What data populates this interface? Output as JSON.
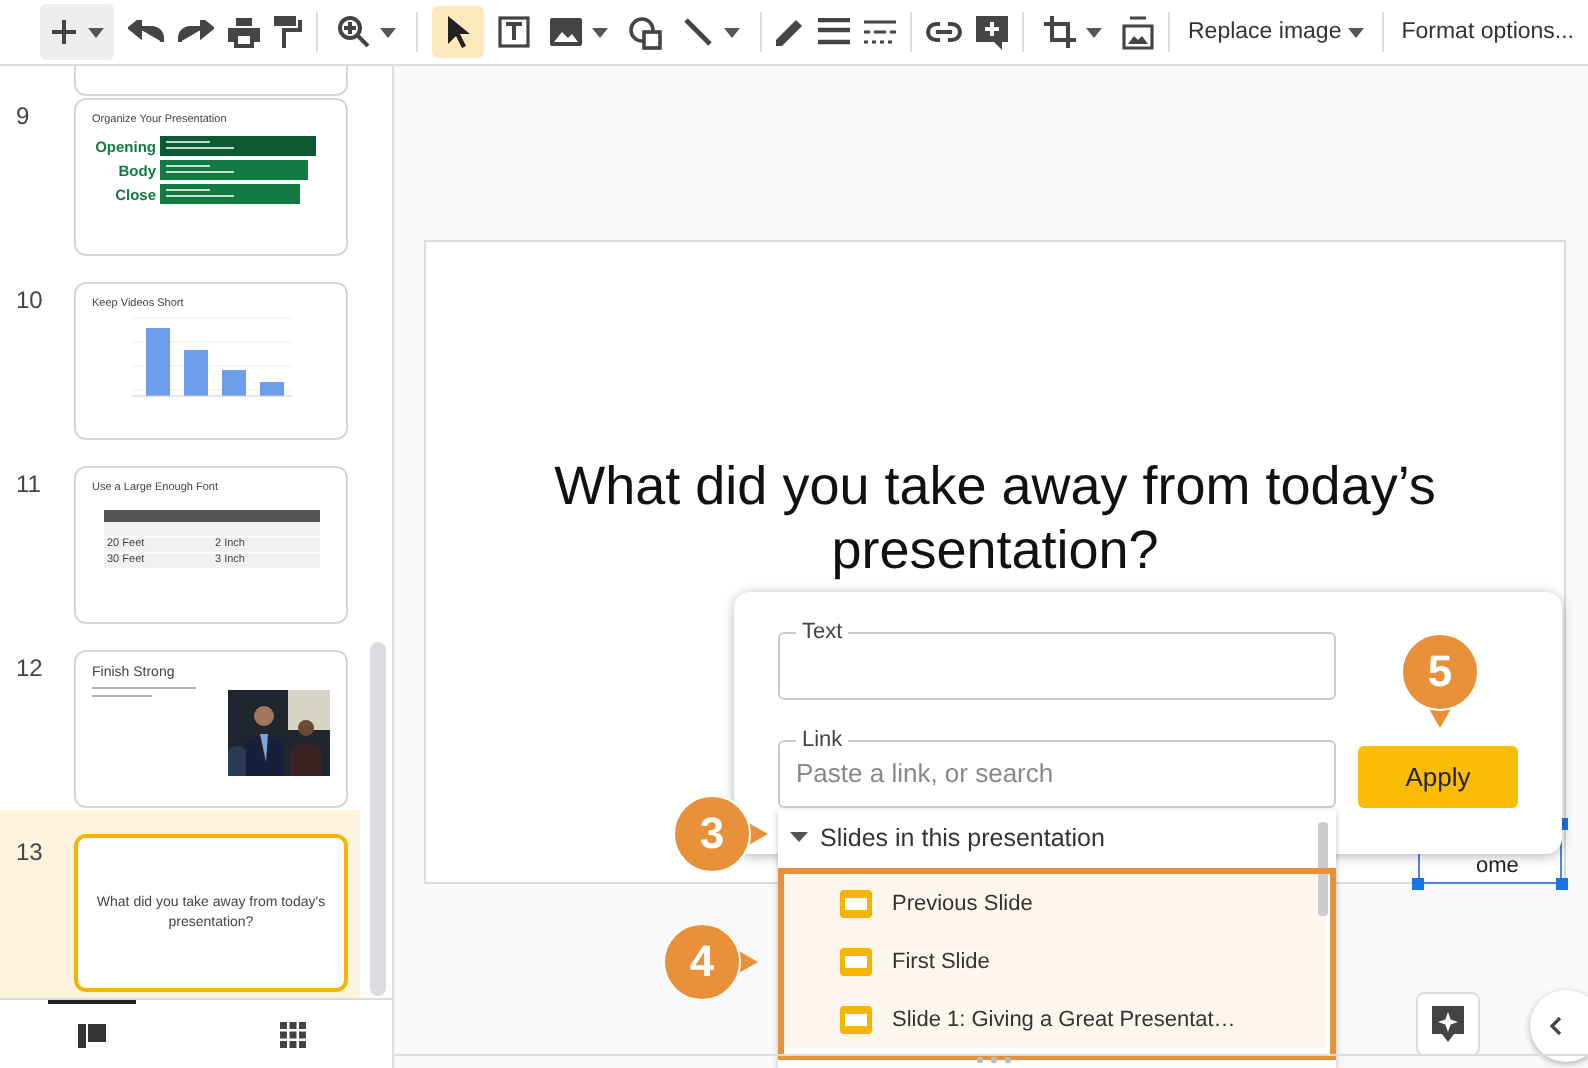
{
  "toolbar": {
    "pointer_selected": true,
    "buttons": [
      {
        "label": "Replace image"
      },
      {
        "label": "Format options..."
      }
    ]
  },
  "slides": [
    {
      "number": "9",
      "kind": "bars",
      "selected": false,
      "title": "Organize Your Presentation",
      "rows": [
        "Opening",
        "Body",
        "Close"
      ]
    },
    {
      "number": "10",
      "kind": "chart",
      "selected": false,
      "title": "Keep Videos Short"
    },
    {
      "number": "11",
      "kind": "table",
      "selected": false,
      "title": "Use a Large Enough Font",
      "rows": [
        [
          "20 Feet",
          "2 Inch"
        ],
        [
          "30 Feet",
          "3 Inch"
        ]
      ]
    },
    {
      "number": "12",
      "selected": false,
      "title": "Finish Strong"
    },
    {
      "number": "13",
      "kind": "text",
      "selected": true,
      "title": "What did you take away from today's presentation?"
    }
  ],
  "slide": {
    "title_lines": [
      "What did you take away from today’s",
      "presentation?"
    ],
    "image_text": "ome"
  },
  "link_popup": {
    "text_label": "Text",
    "link_label": "Link",
    "link_placeholder": "Paste a link, or search",
    "apply": "Apply",
    "section": "Slides in this presentation",
    "section_expanded": true,
    "items": [
      {
        "label": "Previous Slide"
      },
      {
        "label": "First Slide"
      },
      {
        "label": "Slide 1: Giving a Great Presentat…"
      }
    ]
  },
  "callouts": [
    {
      "number": "3"
    },
    {
      "number": "4"
    },
    {
      "number": "5"
    }
  ]
}
